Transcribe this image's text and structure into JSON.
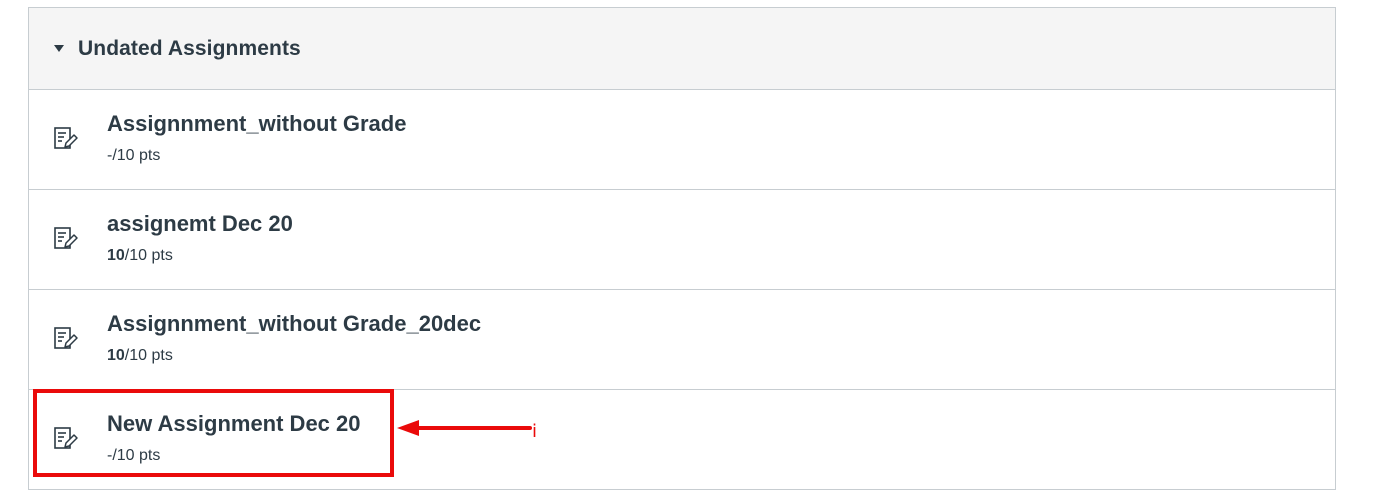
{
  "group": {
    "title": "Undated Assignments",
    "expanded": true
  },
  "assignments": [
    {
      "title": "Assignnment_without Grade",
      "score": "-",
      "points_suffix": "/10 pts",
      "icon": "assignment-icon"
    },
    {
      "title": "assignemt Dec 20",
      "score": "10",
      "points_suffix": "/10 pts",
      "icon": "assignment-icon"
    },
    {
      "title": "Assignnment_without Grade_20dec",
      "score": "10",
      "points_suffix": "/10 pts",
      "icon": "assignment-icon"
    },
    {
      "title": "New Assignment Dec 20",
      "score": "-",
      "points_suffix": "/10 pts",
      "icon": "assignment-icon"
    }
  ],
  "annotation": {
    "label": "i",
    "color": "#ea0a0a",
    "target": "New Assignment Dec 20"
  },
  "colors": {
    "text": "#2d3b45",
    "header_bg": "#f5f5f5",
    "border": "#c7cdd1",
    "annotation": "#ea0a0a"
  }
}
